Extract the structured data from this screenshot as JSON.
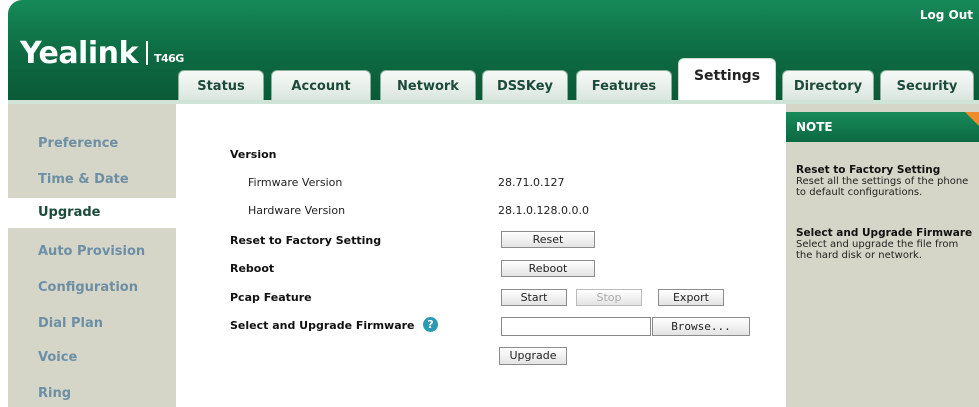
{
  "header": {
    "brand": "Yealink",
    "model": "T46G",
    "logout_label": "Log Out"
  },
  "tabs": [
    {
      "label": "Status"
    },
    {
      "label": "Account"
    },
    {
      "label": "Network"
    },
    {
      "label": "DSSKey"
    },
    {
      "label": "Features"
    },
    {
      "label": "Settings",
      "active": true
    },
    {
      "label": "Directory"
    },
    {
      "label": "Security"
    }
  ],
  "sidebar": {
    "items": [
      {
        "label": "Preference"
      },
      {
        "label": "Time & Date"
      },
      {
        "label": "Upgrade",
        "active": true
      },
      {
        "label": "Auto Provision"
      },
      {
        "label": "Configuration"
      },
      {
        "label": "Dial Plan"
      },
      {
        "label": "Voice"
      },
      {
        "label": "Ring"
      }
    ]
  },
  "main": {
    "version_heading": "Version",
    "firmware_label": "Firmware Version",
    "firmware_value": "28.71.0.127",
    "hardware_label": "Hardware Version",
    "hardware_value": "28.1.0.128.0.0.0",
    "reset_label": "Reset to Factory Setting",
    "reset_button": "Reset",
    "reboot_label": "Reboot",
    "reboot_button": "Reboot",
    "pcap_label": "Pcap Feature",
    "start_button": "Start",
    "stop_button": "Stop",
    "export_button": "Export",
    "upgrade_fw_label": "Select and Upgrade Firmware",
    "help_glyph": "?",
    "file_value": "",
    "browse_button": "Browse...",
    "upgrade_button": "Upgrade"
  },
  "note": {
    "heading": "NOTE",
    "items": [
      {
        "title": "Reset to Factory Setting",
        "text": "Reset all the settings of the phone to default configurations."
      },
      {
        "title": "Select and Upgrade Firmware",
        "text": "Select and upgrade the file from the hard disk or network."
      }
    ]
  },
  "colors": {
    "header_green": "#0d6a42",
    "sidebar_bg": "#d6d6c8",
    "note_accent": "#f08a2b",
    "help_icon": "#2a9bb3"
  }
}
